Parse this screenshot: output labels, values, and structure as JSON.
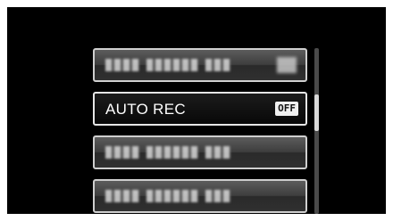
{
  "menu": {
    "items": [
      {
        "id": "item-1",
        "label": "",
        "value": "",
        "selected": false,
        "blurred": true
      },
      {
        "id": "item-2",
        "label": "AUTO REC",
        "value": "OFF",
        "selected": true,
        "blurred": false
      },
      {
        "id": "item-3",
        "label": "",
        "value": "",
        "selected": false,
        "blurred": true
      },
      {
        "id": "item-4",
        "label": "",
        "value": "",
        "selected": false,
        "blurred": true
      }
    ]
  },
  "scrollbar": {
    "position_fraction": 0.28,
    "visible_fraction": 0.22
  },
  "colors": {
    "background": "#000000",
    "item_border": "#cfcfcf",
    "selected_border": "#e6e6e6",
    "text": "#ffffff",
    "badge_bg": "#f0f0f0"
  }
}
